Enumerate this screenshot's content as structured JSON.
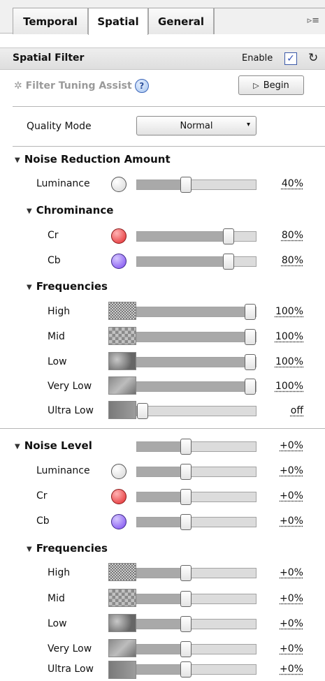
{
  "tabs": [
    {
      "label": "Temporal"
    },
    {
      "label": "Spatial"
    },
    {
      "label": "General"
    }
  ],
  "header": {
    "title": "Spatial Filter",
    "enable_label": "Enable",
    "enable_checked": true,
    "check_glyph": "✓"
  },
  "assist": {
    "label": "Filter Tuning Assist",
    "help_glyph": "?",
    "begin_label": "Begin"
  },
  "quality": {
    "label": "Quality Mode",
    "value": "Normal"
  },
  "noise_reduction": {
    "title": "Noise Reduction Amount",
    "luminance": {
      "label": "Luminance",
      "value": "40%",
      "level": 0.4
    },
    "chrominance_title": "Chrominance",
    "cr": {
      "label": "Cr",
      "value": "80%",
      "level": 0.8
    },
    "cb": {
      "label": "Cb",
      "value": "80%",
      "level": 0.8
    },
    "frequencies_title": "Frequencies",
    "high": {
      "label": "High",
      "value": "100%",
      "level": 1.0
    },
    "mid": {
      "label": "Mid",
      "value": "100%",
      "level": 1.0
    },
    "low": {
      "label": "Low",
      "value": "100%",
      "level": 1.0
    },
    "very_low": {
      "label": "Very Low",
      "value": "100%",
      "level": 1.0
    },
    "ultra_low": {
      "label": "Ultra Low",
      "value": "off",
      "level": 0.0
    }
  },
  "noise_level": {
    "title": "Noise Level",
    "main": {
      "value": "+0%",
      "level": 0.4
    },
    "luminance": {
      "label": "Luminance",
      "value": "+0%",
      "level": 0.4
    },
    "cr": {
      "label": "Cr",
      "value": "+0%",
      "level": 0.4
    },
    "cb": {
      "label": "Cb",
      "value": "+0%",
      "level": 0.4
    },
    "frequencies_title": "Frequencies",
    "high": {
      "label": "High",
      "value": "+0%",
      "level": 0.4
    },
    "mid": {
      "label": "Mid",
      "value": "+0%",
      "level": 0.4
    },
    "low": {
      "label": "Low",
      "value": "+0%",
      "level": 0.4
    },
    "very_low": {
      "label": "Very Low",
      "value": "+0%",
      "level": 0.4
    },
    "ultra_low": {
      "label": "Ultra Low",
      "value": "+0%",
      "level": 0.4
    }
  },
  "colors": {
    "cr": "#e2262a",
    "cb": "#7a48ef",
    "luminance": "#ffffff",
    "check": "#3553b8"
  }
}
